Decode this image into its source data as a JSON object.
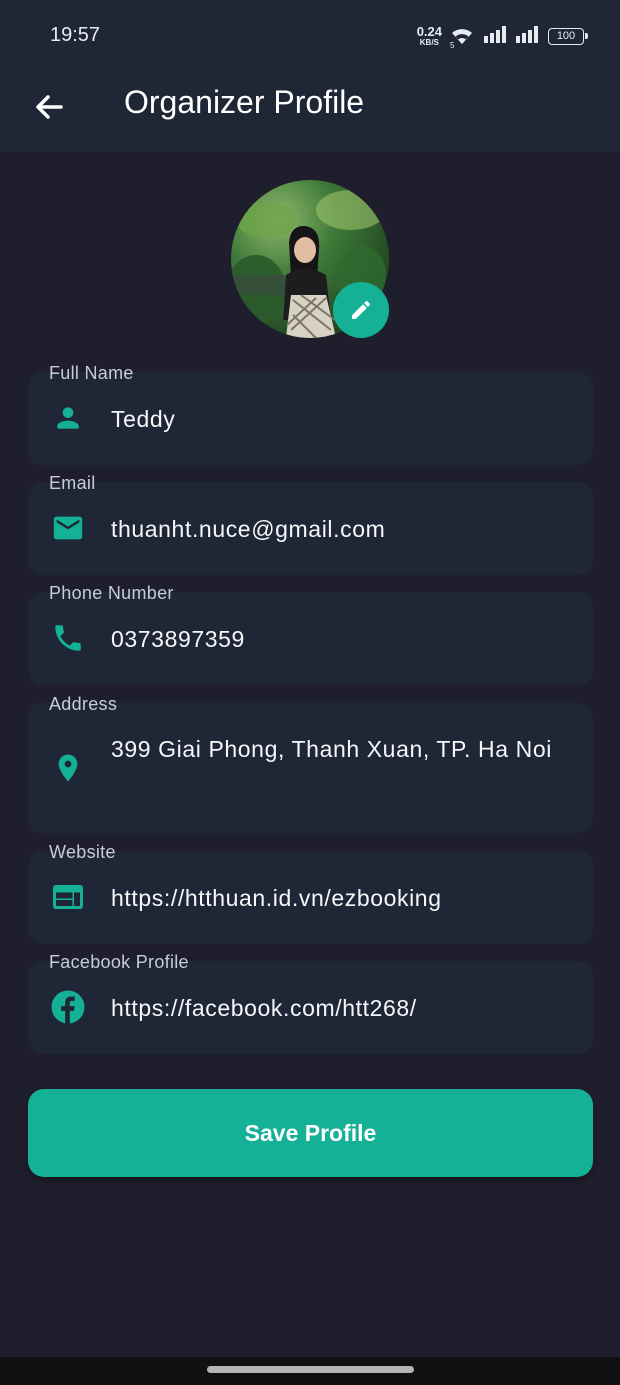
{
  "status": {
    "time": "19:57",
    "net_speed_value": "0.24",
    "net_speed_unit": "KB/S",
    "wifi_badge": "5",
    "battery": "100",
    "icons": [
      "wifi-icon",
      "signal-icon",
      "signal-icon",
      "battery-icon"
    ]
  },
  "appbar": {
    "title": "Organizer Profile",
    "back_icon": "arrow-left-icon"
  },
  "avatar": {
    "edit_icon": "pencil-icon"
  },
  "form": {
    "full_name": {
      "label": "Full Name",
      "value": "Teddy",
      "icon": "person-icon"
    },
    "email": {
      "label": "Email",
      "value": "thuanht.nuce@gmail.com",
      "icon": "mail-icon"
    },
    "phone": {
      "label": "Phone Number",
      "value": "0373897359",
      "icon": "phone-icon"
    },
    "address": {
      "label": "Address",
      "value": "399 Giai Phong, Thanh Xuan, TP. Ha Noi",
      "icon": "location-pin-icon"
    },
    "website": {
      "label": "Website",
      "value": "https://htthuan.id.vn/ezbooking",
      "icon": "web-icon"
    },
    "facebook": {
      "label": "Facebook Profile",
      "value": "https://facebook.com/htt268/",
      "icon": "facebook-icon"
    }
  },
  "save_label": "Save Profile",
  "colors": {
    "accent": "#14b196",
    "background": "#1f1e2c",
    "surface": "#1f2736"
  }
}
